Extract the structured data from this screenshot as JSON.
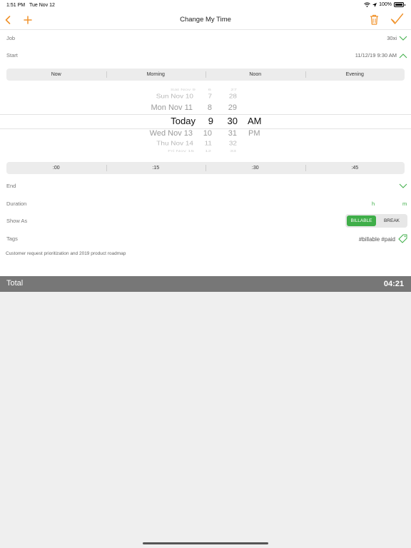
{
  "status": {
    "time": "1:51 PM",
    "date": "Tue Nov 12",
    "battery": "100%"
  },
  "nav": {
    "title": "Change My Time"
  },
  "job": {
    "label": "Job",
    "value": "30xi"
  },
  "start": {
    "label": "Start",
    "value": "11/12/19 9:30 AM"
  },
  "quick_times": [
    "Now",
    "Morning",
    "Noon",
    "Evening"
  ],
  "picker": {
    "days": [
      "Sat Nov 9",
      "Sun Nov 10",
      "Mon Nov 11",
      "Today",
      "Wed Nov 13",
      "Thu Nov 14",
      "Fri Nov 15"
    ],
    "hours": [
      "6",
      "7",
      "8",
      "9",
      "10",
      "11",
      "12"
    ],
    "minutes": [
      "27",
      "28",
      "29",
      "30",
      "31",
      "32",
      "33"
    ],
    "ampm": [
      "AM",
      "PM"
    ]
  },
  "quick_minutes": [
    ":00",
    ":15",
    ":30",
    ":45"
  ],
  "end": {
    "label": "End"
  },
  "duration": {
    "label": "Duration",
    "h": "h",
    "m": "m"
  },
  "show_as": {
    "label": "Show As",
    "billable": "BILLABLE",
    "break": "BREAK"
  },
  "tags": {
    "label": "Tags",
    "value": "#billable #paid"
  },
  "notes": "Customer request prioritization and 2019 product roadmap",
  "total": {
    "label": "Total",
    "value": "04:21"
  },
  "colors": {
    "accent": "#f0922b",
    "green": "#3fae49",
    "total_bar": "#777777"
  }
}
